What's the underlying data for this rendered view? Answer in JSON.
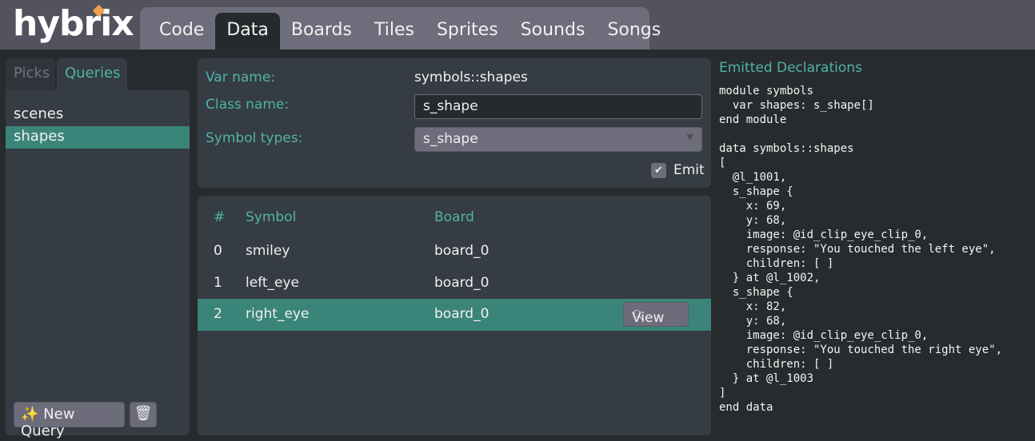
{
  "app": {
    "logo": "hybrix"
  },
  "tabs": [
    "Code",
    "Data",
    "Boards",
    "Tiles",
    "Sprites",
    "Sounds",
    "Songs"
  ],
  "sidebar": {
    "tabs": [
      "Picks",
      "Queries"
    ],
    "items": [
      "scenes",
      "shapes"
    ],
    "new_query": "New Query"
  },
  "form": {
    "var_label": "Var name:",
    "var_value": "symbols::shapes",
    "class_label": "Class name:",
    "class_value": "s_shape",
    "types_label": "Symbol types:",
    "types_value": "s_shape",
    "emit_label": "Emit"
  },
  "table": {
    "headers": [
      "#",
      "Symbol",
      "Board"
    ],
    "rows": [
      [
        "0",
        "smiley",
        "board_0"
      ],
      [
        "1",
        "left_eye",
        "board_0"
      ],
      [
        "2",
        "right_eye",
        "board_0"
      ]
    ],
    "view_label": "View"
  },
  "emitted": {
    "title": "Emitted Declarations",
    "code": "module symbols\n  var shapes: s_shape[]\nend module\n\ndata symbols::shapes\n[\n  @l_1001,\n  s_shape {\n    x: 69,\n    y: 68,\n    image: @id_clip_eye_clip_0,\n    response: \"You touched the left eye\",\n    children: [ ]\n  } at @l_1002,\n  s_shape {\n    x: 82,\n    y: 68,\n    image: @id_clip_eye_clip_0,\n    response: \"You touched the right eye\",\n    children: [ ]\n  } at @l_1003\n]\nend data"
  }
}
